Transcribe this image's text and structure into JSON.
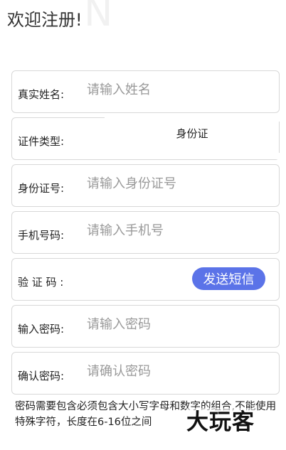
{
  "header": {
    "title": "欢迎注册!",
    "watermark": "N"
  },
  "form": {
    "name": {
      "label": "真实姓名:",
      "placeholder": "请输入姓名"
    },
    "id_type": {
      "label": "证件类型:",
      "value": "身份证"
    },
    "id_number": {
      "label": "身份证号:",
      "placeholder": "请输入身份证号"
    },
    "phone": {
      "label": "手机号码:",
      "placeholder": "请输入手机号"
    },
    "code": {
      "label": "验 证 码 :",
      "send_label": "发送短信"
    },
    "password": {
      "label": "输入密码:",
      "placeholder": "请输入密码"
    },
    "confirm": {
      "label": "确认密码:",
      "placeholder": "请确认密码"
    }
  },
  "hint": {
    "text": "密码需要包含必须包含大小写字母和数字的组合,不能使用特殊字符，长度在6-16位之间"
  },
  "brand": {
    "logo_text": "大玩客"
  },
  "colors": {
    "accent": "#5b73e8",
    "border": "#d8d8d8",
    "placeholder": "#999999"
  }
}
